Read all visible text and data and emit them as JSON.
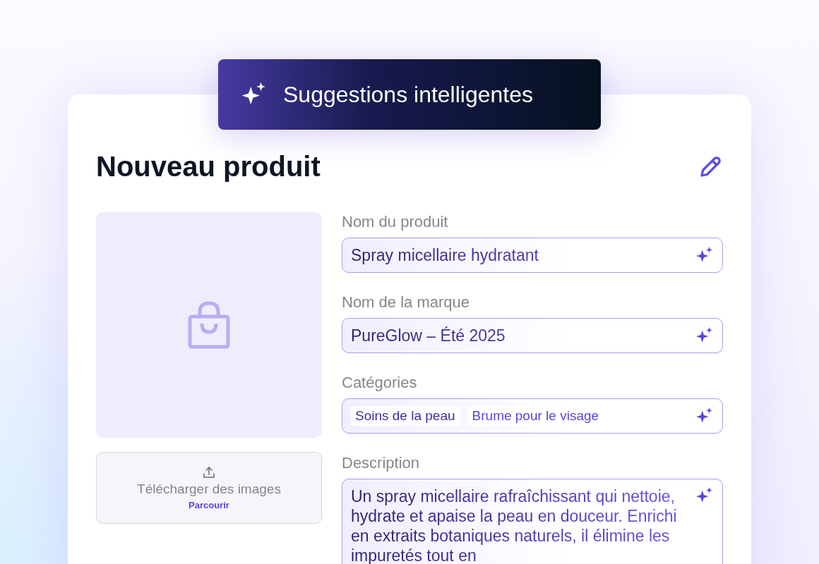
{
  "banner": {
    "title": "Suggestions intelligentes"
  },
  "card": {
    "title": "Nouveau produit"
  },
  "upload": {
    "label": "Télécharger des images",
    "link": "Parcourir"
  },
  "fields": [
    {
      "kind": "text",
      "label": "Nom du produit",
      "value": "Spray micellaire hydratant"
    },
    {
      "kind": "text",
      "label": "Nom de la marque",
      "value": "PureGlow – Été 2025"
    },
    {
      "kind": "tags",
      "label": "Catégories",
      "tags": [
        "Soins de la peau",
        "Brume pour le visage"
      ]
    },
    {
      "kind": "textarea",
      "label": "Description",
      "value": "Un spray micellaire rafraîchissant qui nettoie, hydrate et apaise la peau en douceur. Enrichi en extraits botaniques naturels, il élimine les impuretés tout en"
    }
  ]
}
